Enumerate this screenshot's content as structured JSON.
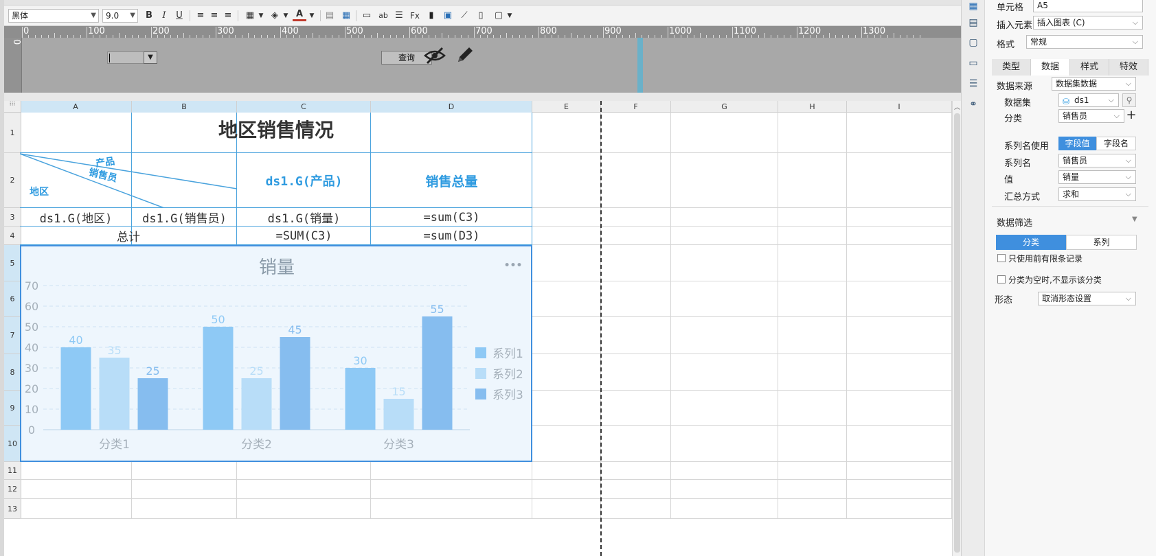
{
  "toolbar": {
    "font_name": "黑体",
    "font_size": "9.0",
    "bold": "B",
    "italic": "I",
    "underline": "U"
  },
  "ruler": {
    "marks": [
      "0",
      "100",
      "200",
      "300",
      "400",
      "500",
      "600",
      "700",
      "800",
      "900",
      "1000",
      "1100",
      "1200",
      "1300"
    ]
  },
  "param": {
    "vruler_label": "0",
    "query_label": "查询",
    "combo_value": ""
  },
  "grid": {
    "columns": [
      "A",
      "B",
      "C",
      "D",
      "E",
      "F",
      "G",
      "H",
      "I"
    ],
    "rows": [
      "1",
      "2",
      "3",
      "4",
      "5",
      "6",
      "7",
      "8",
      "9",
      "10",
      "11",
      "12",
      "13"
    ]
  },
  "report": {
    "title": "地区销售情况",
    "header_diag_product": "产品",
    "header_diag_seller": "销售员",
    "header_diag_region": "地区",
    "c2": "ds1.G(产品)",
    "d2": "销售总量",
    "a3": "ds1.G(地区)",
    "b3": "ds1.G(销售员)",
    "c3": "ds1.G(销量)",
    "d3": "=sum(C3)",
    "a4": "总计",
    "c4": "=SUM(C3)",
    "d4": "=sum(D3)"
  },
  "chart_data": {
    "type": "bar",
    "title": "销量",
    "more_label": "•••",
    "categories": [
      "分类1",
      "分类2",
      "分类3"
    ],
    "series": [
      {
        "name": "系列1",
        "values": [
          40,
          50,
          30
        ],
        "color": "#8ec9f5"
      },
      {
        "name": "系列2",
        "values": [
          35,
          25,
          15
        ],
        "color": "#b8ddf8"
      },
      {
        "name": "系列3",
        "values": [
          25,
          45,
          55
        ],
        "color": "#86bdef"
      }
    ],
    "ylim": [
      0,
      70
    ],
    "yticks": [
      "0",
      "10",
      "20",
      "30",
      "40",
      "50",
      "60",
      "70"
    ],
    "legend": "right",
    "grid": true
  },
  "panel": {
    "cell_label": "单元格",
    "cell_value": "A5",
    "insert_label": "插入元素",
    "insert_value": "插入图表 (C)",
    "format_label": "格式",
    "format_value": "常规",
    "tabs": [
      "类型",
      "数据",
      "样式",
      "特效"
    ],
    "datasource_label": "数据来源",
    "datasource_value": "数据集数据",
    "dataset_label": "数据集",
    "dataset_value": "ds1",
    "category_label": "分类",
    "category_value": "销售员",
    "series_use_label": "系列名使用",
    "series_use_opt1": "字段值",
    "series_use_opt2": "字段名",
    "series_name_label": "系列名",
    "series_name_value": "销售员",
    "value_label": "值",
    "value_value": "销量",
    "agg_label": "汇总方式",
    "agg_value": "求和",
    "filter_label": "数据筛选",
    "filter_tab1": "分类",
    "filter_tab2": "系列",
    "check1": "只使用前有限条记录",
    "check2": "分类为空时,不显示该分类",
    "form_label": "形态",
    "form_value": "取消形态设置"
  },
  "colors": {
    "accent": "#4aa3dd",
    "header_text": "#2f9be0",
    "chart_bg": "#eef6fd",
    "selection": "#3f8fde"
  }
}
